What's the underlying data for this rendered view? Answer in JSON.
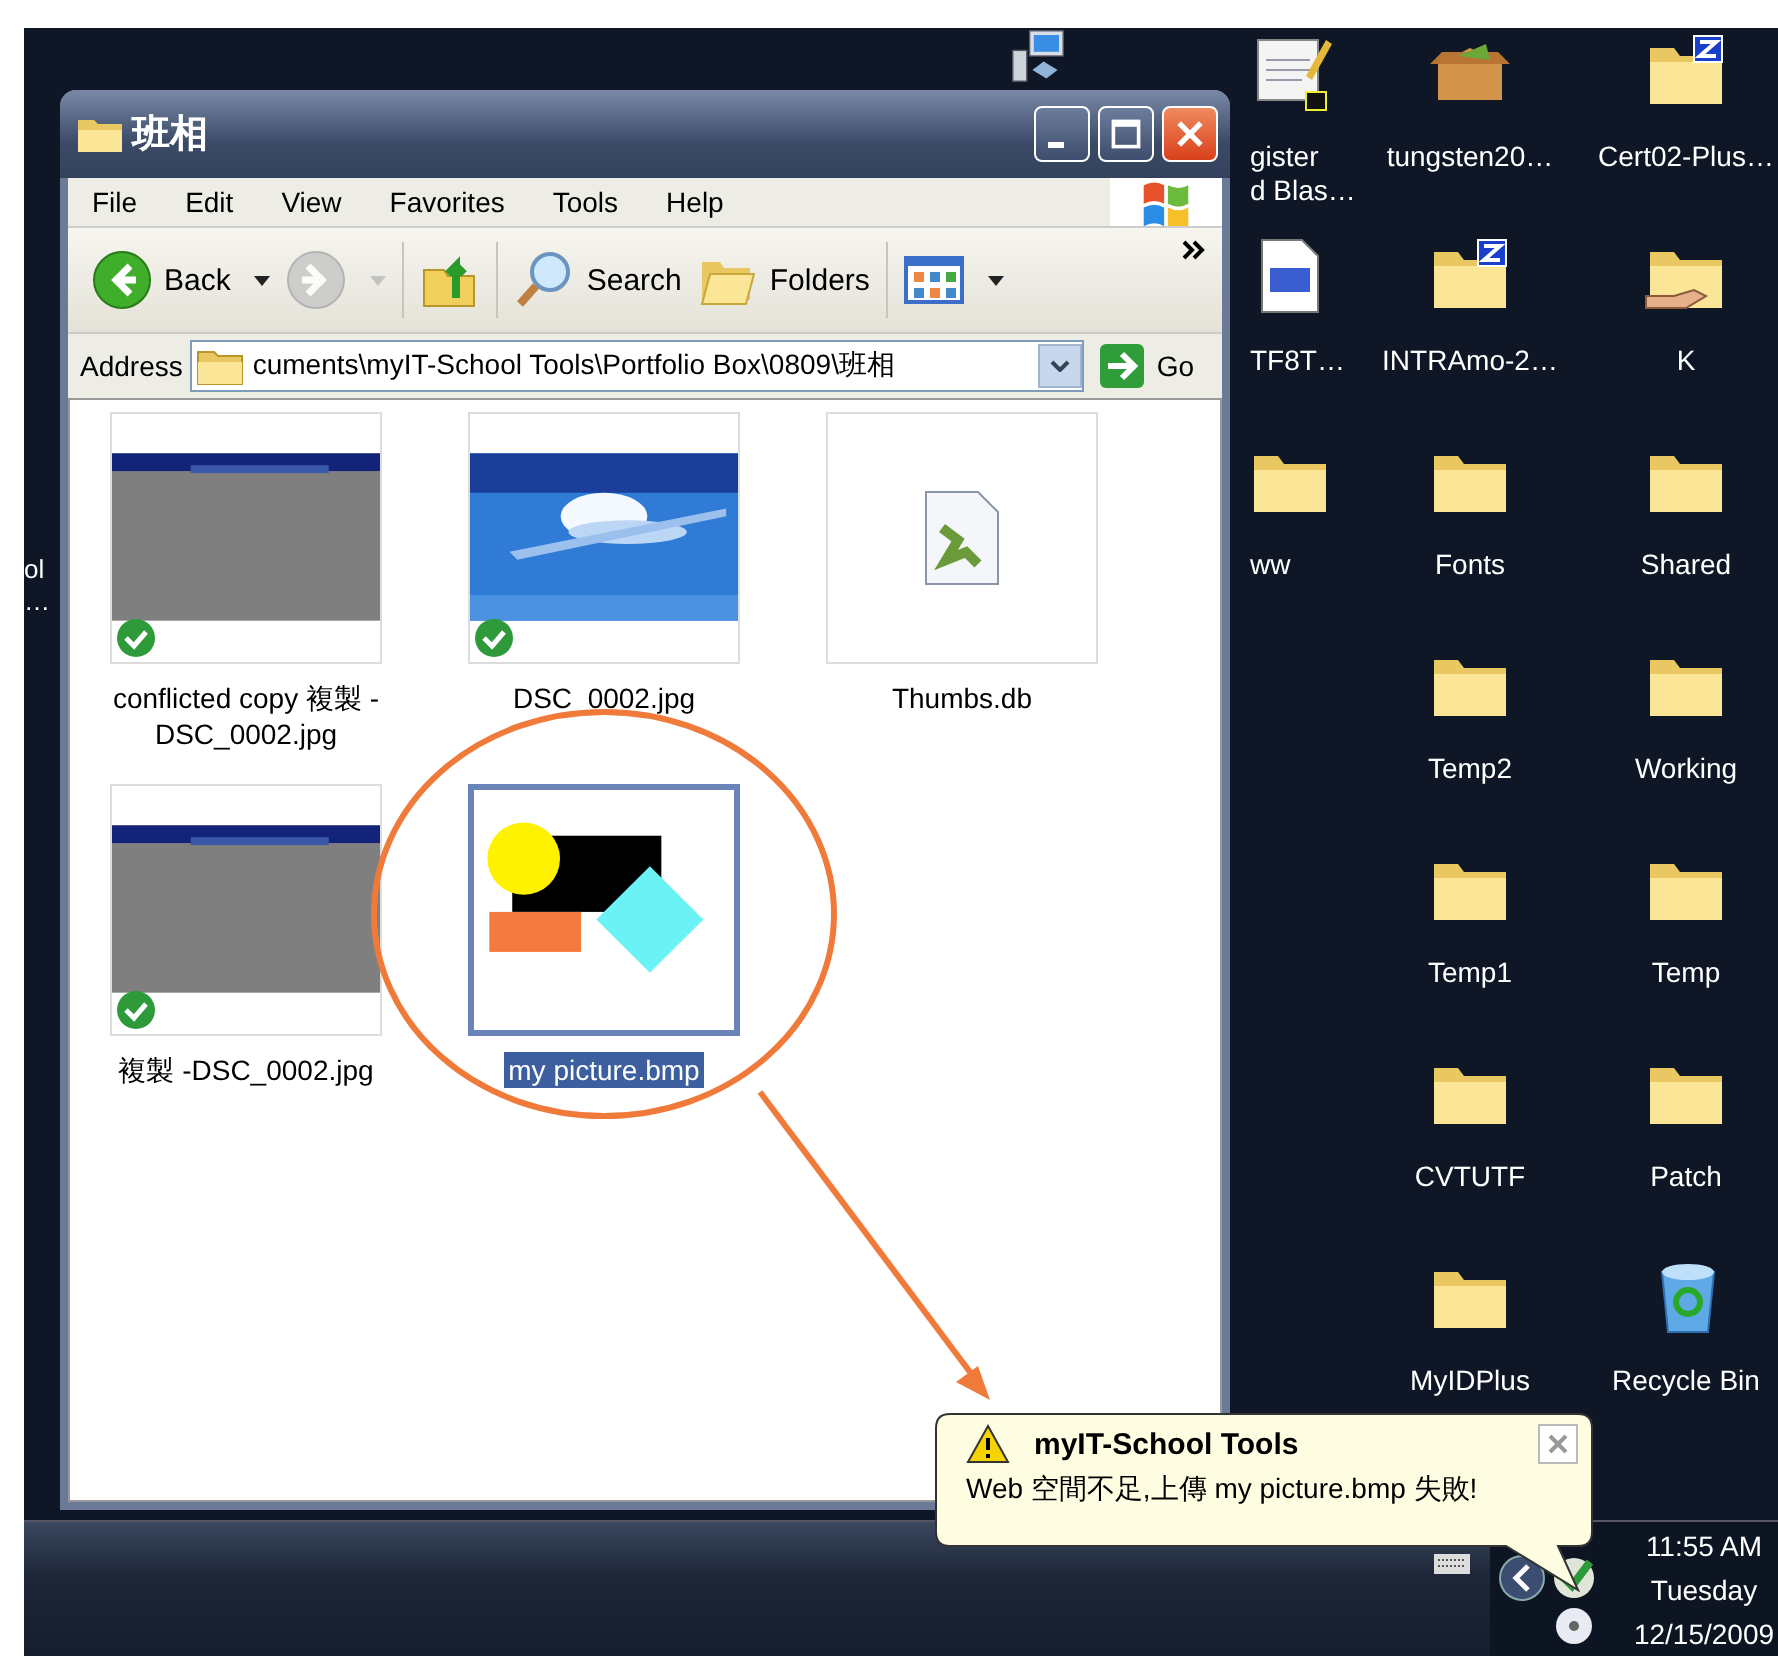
{
  "desktop": {
    "edge_label": [
      "ol",
      "…"
    ],
    "columns": [
      {
        "icons": [
          {
            "kind": "network"
          }
        ]
      },
      {
        "icons": [
          {
            "kind": "register",
            "lines": [
              "gister",
              "d Blas…"
            ]
          },
          {
            "kind": "webpage",
            "lines": [
              "TF8T…"
            ]
          },
          {
            "kind": "folder",
            "lines": [
              "ww"
            ]
          }
        ]
      },
      {
        "icons": [
          {
            "kind": "box",
            "lines": [
              "tungsten20…"
            ]
          },
          {
            "kind": "zip",
            "lines": [
              "INTRAmo-2…"
            ]
          },
          {
            "kind": "folder",
            "lines": [
              "Fonts"
            ]
          },
          {
            "kind": "folder",
            "lines": [
              "Temp2"
            ]
          },
          {
            "kind": "folder",
            "lines": [
              "Temp1"
            ]
          },
          {
            "kind": "folder",
            "lines": [
              "CVTUTF"
            ]
          },
          {
            "kind": "folder",
            "lines": [
              "MyIDPlus"
            ]
          }
        ]
      },
      {
        "icons": [
          {
            "kind": "zip",
            "lines": [
              "Cert02-Plus…"
            ]
          },
          {
            "kind": "shared",
            "lines": [
              "K"
            ]
          },
          {
            "kind": "folder",
            "lines": [
              "Shared"
            ]
          },
          {
            "kind": "folder",
            "lines": [
              "Working"
            ]
          },
          {
            "kind": "folder",
            "lines": [
              "Temp"
            ]
          },
          {
            "kind": "folder",
            "lines": [
              "Patch"
            ]
          },
          {
            "kind": "recycle",
            "lines": [
              "Recycle Bin"
            ]
          }
        ]
      }
    ]
  },
  "window": {
    "title": "班相",
    "menu": [
      "File",
      "Edit",
      "View",
      "Favorites",
      "Tools",
      "Help"
    ],
    "toolbar": [
      {
        "kind": "back",
        "label": "Back",
        "disabled": false
      },
      {
        "kind": "forward",
        "disabled": true
      },
      {
        "kind": "up",
        "disabled": false
      },
      {
        "kind": "search",
        "label": "Search",
        "disabled": false
      },
      {
        "kind": "folders",
        "label": "Folders",
        "disabled": false
      },
      {
        "kind": "views",
        "disabled": false
      }
    ],
    "address": {
      "label": "Address",
      "value": "cuments\\myIT-School Tools\\Portfolio Box\\0809\\班相",
      "go": "Go"
    },
    "files": [
      {
        "name": "conflicted copy 複製 -DSC_0002.jpg",
        "kind": "picture",
        "synced": true,
        "selected": false
      },
      {
        "name": "DSC_0002.jpg",
        "kind": "picture",
        "synced": true,
        "selected": false
      },
      {
        "name": "Thumbs.db",
        "kind": "file",
        "synced": false,
        "selected": false
      },
      {
        "name": "複製 -DSC_0002.jpg",
        "kind": "picture",
        "synced": true,
        "selected": false
      },
      {
        "name": "my picture.bmp",
        "kind": "picture",
        "synced": false,
        "selected": true
      }
    ]
  },
  "balloon": {
    "title": "myIT-School Tools",
    "message": "Web 空間不足,上傳 my picture.bmp 失敗!"
  },
  "clock": {
    "time": "11:55 AM",
    "day": "Tuesday",
    "date": "12/15/2009"
  }
}
